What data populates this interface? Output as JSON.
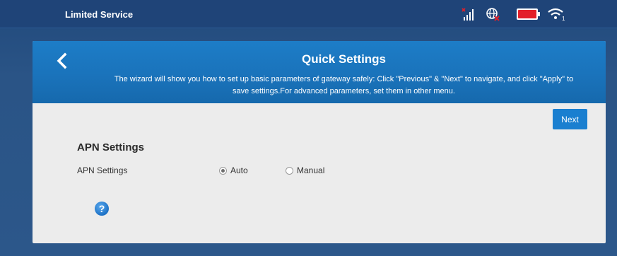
{
  "status_bar": {
    "service_text": "Limited Service",
    "icons": [
      "signal-icon",
      "globe-icon",
      "battery-icon",
      "wifi-icon"
    ],
    "accent_red": "#e3202a"
  },
  "header": {
    "back_icon": "chevron-left-icon",
    "title": "Quick Settings",
    "description_line1": "The wizard will show you how to set up basic parameters of gateway safely: Click \"Previous\" & \"Next\" to navigate, and click \"Apply\" to",
    "description_line2": "save settings.For advanced parameters, set them in other menu.",
    "color": "#1a73bb"
  },
  "toolbar": {
    "next_label": "Next"
  },
  "apn": {
    "section_title": "APN Settings",
    "field_label": "APN Settings",
    "options": [
      {
        "label": "Auto",
        "checked": true
      },
      {
        "label": "Manual",
        "checked": false
      }
    ]
  },
  "help": {
    "icon": "help-icon",
    "glyph": "?"
  }
}
